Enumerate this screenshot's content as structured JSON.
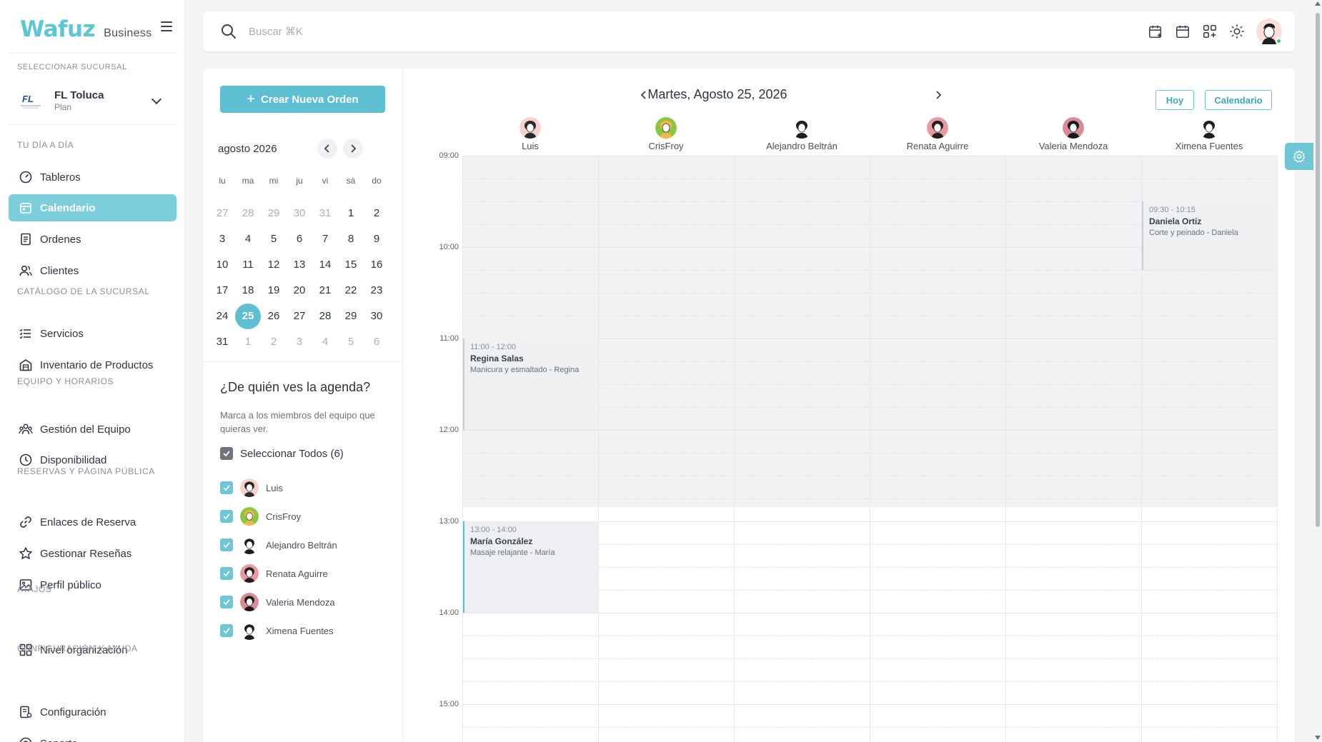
{
  "brand": {
    "logo": "Wafuz",
    "sub": "Business"
  },
  "sidebar": {
    "branch_label": "SELECCIONAR SUCURSAL",
    "branch_logo": "FL",
    "branch_name": "FL Toluca",
    "branch_plan": "Plan",
    "sections": [
      {
        "label": "TU DÍA A DÍA",
        "items": [
          {
            "label": "Tableros",
            "icon": "dashboard-icon"
          },
          {
            "label": "Calendario",
            "icon": "calendar-icon",
            "active": true
          },
          {
            "label": "Ordenes",
            "icon": "orders-icon"
          },
          {
            "label": "Clientes",
            "icon": "clients-icon"
          }
        ]
      },
      {
        "label": "CATÁLOGO DE LA SUCURSAL",
        "items": [
          {
            "label": "Servicios",
            "icon": "services-icon"
          },
          {
            "label": "Inventario de Productos",
            "icon": "inventory-icon"
          }
        ]
      },
      {
        "label": "EQUIPO Y HORARIOS",
        "items": [
          {
            "label": "Gestión del Equipo",
            "icon": "team-icon"
          },
          {
            "label": "Disponibilidad",
            "icon": "clock-icon"
          }
        ]
      },
      {
        "label": "RESERVAS Y PÁGINA PÚBLICA",
        "items": [
          {
            "label": "Enlaces de Reserva",
            "icon": "link-icon"
          },
          {
            "label": "Gestionar Reseñas",
            "icon": "star-icon"
          },
          {
            "label": "Perfil público",
            "icon": "image-icon"
          }
        ]
      },
      {
        "label": "ATAJOS",
        "items": [
          {
            "label": "Nivel organización",
            "icon": "grid-icon"
          }
        ]
      },
      {
        "label": "CONFIGURACIÓN Y AYUDA",
        "items": [
          {
            "label": "Configuración",
            "icon": "config-icon"
          },
          {
            "label": "Soporte",
            "icon": "support-icon"
          }
        ]
      }
    ]
  },
  "topbar": {
    "search_placeholder": "Buscar ⌘K",
    "icons": [
      "calendar-add-icon",
      "calendar-icon",
      "apps-add-icon",
      "sun-icon"
    ]
  },
  "left_panel": {
    "create_button": "Crear Nueva Orden",
    "month_title": "agosto 2026",
    "weekdays": [
      "lu",
      "ma",
      "mi",
      "ju",
      "vi",
      "sá",
      "do"
    ],
    "weeks": [
      [
        "27",
        "28",
        "29",
        "30",
        "31",
        "1",
        "2"
      ],
      [
        "3",
        "4",
        "5",
        "6",
        "7",
        "8",
        "9"
      ],
      [
        "10",
        "11",
        "12",
        "13",
        "14",
        "15",
        "16"
      ],
      [
        "17",
        "18",
        "19",
        "20",
        "21",
        "22",
        "23"
      ],
      [
        "24",
        "25",
        "26",
        "27",
        "28",
        "29",
        "30"
      ],
      [
        "31",
        "1",
        "2",
        "3",
        "4",
        "5",
        "6"
      ]
    ],
    "selected_day": "25",
    "agenda_title": "¿De quién ves la agenda?",
    "agenda_desc": "Marca a los miembros del equipo que quieras ver.",
    "select_all": "Seleccionar Todos (6)"
  },
  "calendar": {
    "date_title": "Martes, Agosto 25, 2026",
    "today_button": "Hoy",
    "view_button": "Calendario",
    "hours": [
      "09:00",
      "10:00",
      "11:00",
      "12:00",
      "13:00",
      "14:00",
      "15:00"
    ],
    "staff": [
      {
        "name": "Luis",
        "color": "#f6d2cc",
        "hair": "#2a2a2a"
      },
      {
        "name": "CrisFroy",
        "color": "#8cc63f",
        "hair": "#f5b54a"
      },
      {
        "name": "Alejandro Beltrán",
        "color": "#ffffff",
        "hair": "#1e1e1e"
      },
      {
        "name": "Renata Aguirre",
        "color": "#e79aa0",
        "hair": "#2b1c22"
      },
      {
        "name": "Valeria Mendoza",
        "color": "#d98c93",
        "hair": "#1a1a1a"
      },
      {
        "name": "Ximena Fuentes",
        "color": "#ffffff",
        "hair": "#1e1e1e"
      }
    ],
    "events": [
      {
        "staff_index": 5,
        "start": 9.5,
        "end": 10.25,
        "time": "09:30 - 10:15",
        "client": "Daniela Ortiz",
        "service": "Corte y peinado - Daniela"
      },
      {
        "staff_index": 0,
        "start": 11.0,
        "end": 12.0,
        "time": "11:00 - 12:00",
        "client": "Regina Salas",
        "service": "Manicura y esmaltado - Regina"
      },
      {
        "staff_index": 0,
        "start": 13.0,
        "end": 14.0,
        "time": "13:00 - 14:00",
        "client": "María González",
        "service": "Masaje relajante - María",
        "active": true
      }
    ]
  }
}
